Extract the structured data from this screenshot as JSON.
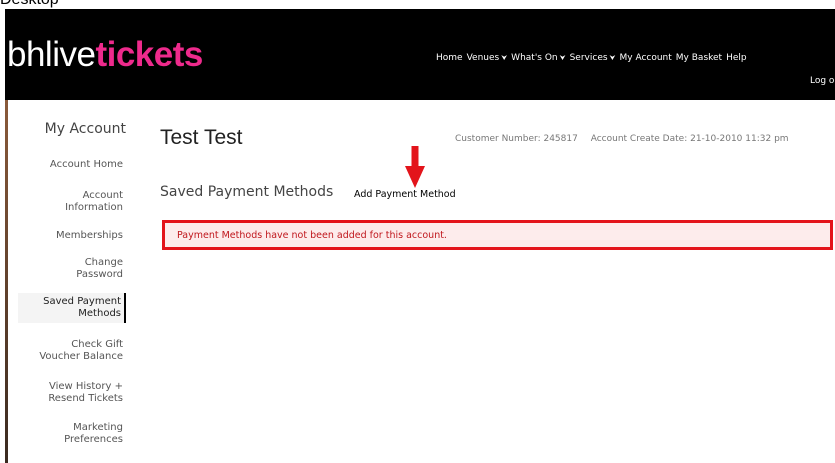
{
  "page_label": "Desktop",
  "header": {
    "logo_part_a": "bhlive",
    "logo_part_b": "tickets",
    "nav": [
      {
        "label": "Home",
        "dropdown": false
      },
      {
        "label": "Venues",
        "dropdown": true
      },
      {
        "label": "What's On",
        "dropdown": true
      },
      {
        "label": "Services",
        "dropdown": true
      },
      {
        "label": "My Account",
        "dropdown": false
      },
      {
        "label": "My Basket",
        "dropdown": false
      },
      {
        "label": "Help",
        "dropdown": false
      }
    ],
    "logout": "Log o",
    "chevron_glyph": "✔",
    "colors": {
      "bar": "#000000",
      "logo_accent": "#ee2a8c"
    }
  },
  "sidebar": {
    "title": "My Account",
    "items": [
      {
        "label": "Account Home"
      },
      {
        "label": "Account\nInformation"
      },
      {
        "label": "Memberships"
      },
      {
        "label": "Change\nPassword"
      },
      {
        "label": "Saved Payment\nMethods",
        "active": true
      },
      {
        "label": "Check Gift\nVoucher Balance"
      },
      {
        "label": "View History +\nResend Tickets"
      },
      {
        "label": "Marketing\nPreferences"
      }
    ]
  },
  "main": {
    "title": "Test Test",
    "customer_number_label": "Customer Number:",
    "customer_number": "245817",
    "create_date_label": "Account Create Date:",
    "create_date": "21-10-2010 11:32 pm",
    "section_title": "Saved Payment Methods",
    "add_link": "Add Payment Method",
    "alert": "Payment Methods have not been added for this account.",
    "colors": {
      "alert_border": "#e3141b",
      "alert_bg": "#fdecec",
      "alert_text": "#c0171d",
      "annotation_arrow": "#e3141b"
    }
  }
}
